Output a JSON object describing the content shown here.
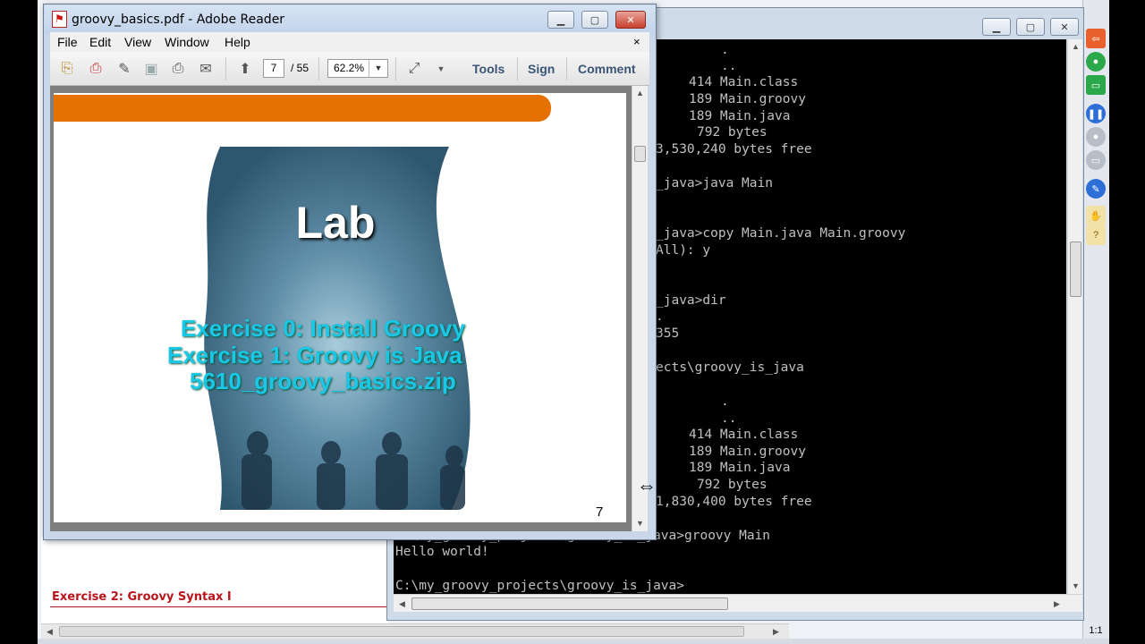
{
  "reader": {
    "title": "groovy_basics.pdf - Adobe Reader",
    "menu": [
      "File",
      "Edit",
      "View",
      "Window",
      "Help"
    ],
    "menu_close": "×",
    "page_current": "7",
    "page_total": "/ 55",
    "zoom": "62.2%",
    "tools_label": "Tools",
    "sign_label": "Sign",
    "comment_label": "Comment",
    "slide": {
      "title": "Lab",
      "line1": "Exercise 0: Install Groovy",
      "line2": "Exercise 1: Groovy is Java",
      "line3": "5610_groovy_basics.zip",
      "page_number": "7"
    }
  },
  "console": {
    "lines": [
      ".",
      "..",
      "414 Main.class",
      "189 Main.groovy",
      "189 Main.java",
      "792 bytes",
      "3,530,240 bytes free",
      "_java>java Main",
      "_java>copy Main.java Main.groovy",
      "All): y",
      "_java>dir",
      ".",
      "355",
      "ects\\groovy_is_java",
      ".",
      "..",
      "414 Main.class",
      "189 Main.groovy",
      "189 Main.java",
      "792 bytes",
      "1,830,400 bytes free",
      "C:\\my_groovy_projects\\groovy_is_java>groovy Main",
      "Hello world!",
      "C:\\my_groovy_projects\\groovy_is_java>"
    ]
  },
  "browser": {
    "exercise_link": "Exercise 2: Groovy Syntax I",
    "zoom_ratio": "1:1"
  },
  "colors": {
    "accent_orange": "#e57200",
    "slide_cyan": "#18c8e6",
    "link_red": "#b8141b"
  }
}
